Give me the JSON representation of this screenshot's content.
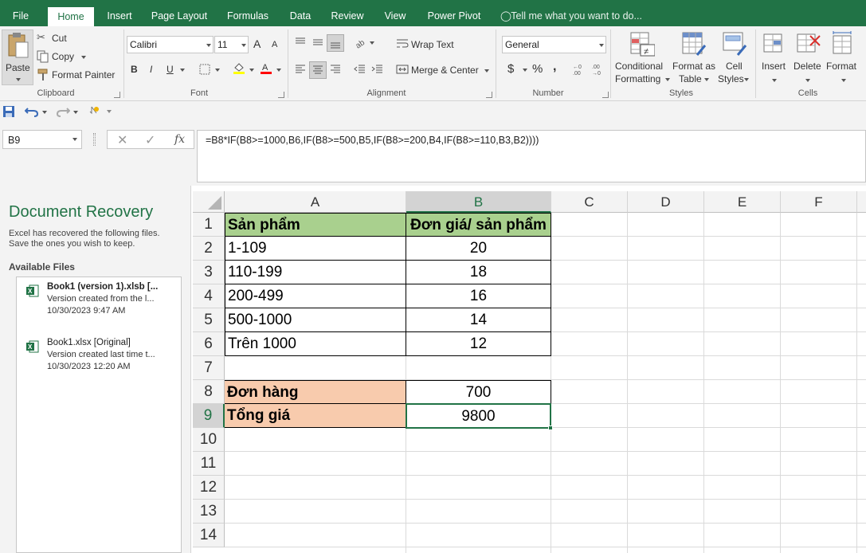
{
  "ribbon_tabs": [
    "File",
    "Home",
    "Insert",
    "Page Layout",
    "Formulas",
    "Data",
    "Review",
    "View",
    "Power Pivot"
  ],
  "active_tab": "Home",
  "tell_me": "Tell me what you want to do...",
  "clipboard": {
    "paste": "Paste",
    "cut": "Cut",
    "copy": "Copy",
    "format_painter": "Format Painter",
    "label": "Clipboard"
  },
  "font": {
    "name": "Calibri",
    "size": "11",
    "bold": "B",
    "italic": "I",
    "underline": "U",
    "grow": "A",
    "shrink": "A",
    "label": "Font"
  },
  "alignment": {
    "wrap": "Wrap Text",
    "merge": "Merge & Center",
    "label": "Alignment"
  },
  "number": {
    "format": "General",
    "currency": "$",
    "percent": "%",
    "comma": ",",
    "label": "Number"
  },
  "styles": {
    "conditional_1": "Conditional",
    "conditional_2": "Formatting",
    "format_table_1": "Format as",
    "format_table_2": "Table",
    "cell_styles_1": "Cell",
    "cell_styles_2": "Styles",
    "label": "Styles"
  },
  "cells_group": {
    "insert": "Insert",
    "delete": "Delete",
    "format": "Format",
    "label": "Cells"
  },
  "formula_bar": {
    "name_box": "B9",
    "fx": "fx",
    "formula": "=B8*IF(B8>=1000,B6,IF(B8>=500,B5,IF(B8>=200,B4,IF(B8>=110,B3,B2))))"
  },
  "recovery": {
    "title": "Document Recovery",
    "desc_1": "Excel has recovered the following files.",
    "desc_2": "Save the ones you wish to keep.",
    "available": "Available Files",
    "files": [
      {
        "name": "Book1 (version 1).xlsb  [...",
        "note": "Version created from the l...",
        "time": "10/30/2023 9:47 AM"
      },
      {
        "name": "Book1.xlsx  [Original]",
        "note": "Version created last time t...",
        "time": "10/30/2023 12:20 AM"
      }
    ]
  },
  "sheet": {
    "columns": [
      "A",
      "B",
      "C",
      "D",
      "E",
      "F"
    ],
    "rows": [
      "1",
      "2",
      "3",
      "4",
      "5",
      "6",
      "7",
      "8",
      "9",
      "10",
      "11",
      "12",
      "13",
      "14"
    ],
    "selected_col": "B",
    "selected_row": "9",
    "cells": {
      "A1": "Sản phẩm",
      "B1": "Đơn giá/ sản phẩm",
      "A2": "1-109",
      "B2": "20",
      "A3": "110-199",
      "B3": "18",
      "A4": "200-499",
      "B4": "16",
      "A5": "500-1000",
      "B5": "14",
      "A6": "Trên 1000",
      "B6": "12",
      "A8": "Đơn hàng",
      "B8": "700",
      "A9": "Tổng giá",
      "B9": "9800"
    },
    "colors": {
      "header_green": "#a9d08e",
      "label_peach": "#f8cbad",
      "excel_green": "#217346"
    }
  }
}
